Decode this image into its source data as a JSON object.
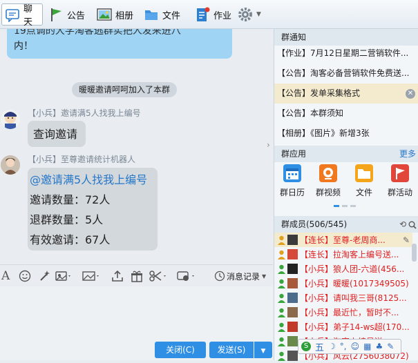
{
  "toolbar": {
    "items": [
      {
        "label": "聊天",
        "icon": "chat-icon"
      },
      {
        "label": "公告",
        "icon": "flag-icon"
      },
      {
        "label": "相册",
        "icon": "photo-icon"
      },
      {
        "label": "文件",
        "icon": "folder-icon"
      },
      {
        "label": "作业",
        "icon": "homework-icon"
      }
    ],
    "settings_icon": "gear-icon"
  },
  "chat": {
    "top_bubble_line1": "19点调的大学淘客逃群实把人发来进八",
    "top_bubble_line2": "内！",
    "system_message": "暖暖邀请呵呵加入了本群",
    "messages": [
      {
        "sender": "【小兵】邀请满5人找我上编号",
        "lines": [
          "查询邀请"
        ]
      },
      {
        "sender": "【小兵】至尊邀请统计机器人",
        "lines": [
          "@邀请满5人找我上编号",
          "邀请数量：72人",
          "退群数量：5人",
          "有效邀请：67人"
        ]
      }
    ]
  },
  "input_toolbar": {
    "history_label": "消息记录"
  },
  "buttons": {
    "close": "关闭(C)",
    "send": "发送(S)"
  },
  "right_panel": {
    "notices_title": "群通知",
    "notices": [
      "【作业】7月12日星期二营销软件...",
      "【公告】淘客必备营销软件免费送...",
      "【公告】发单采集格式",
      "【公告】本群须知",
      "【相册】《图片》新增3张"
    ],
    "apps_title": "群应用",
    "apps_more": "更多",
    "apps": [
      "群日历",
      "群视频",
      "文件",
      "群活动"
    ],
    "members_title": "群成员(506/545)",
    "members": [
      "【连长】至尊-老周商...",
      "【连长】拉淘客上编号送...",
      "【小兵】狼人团-六道(456...",
      "【小兵】暖暖(1017349505)",
      "【小兵】请叫我三哥(8125...",
      "【小兵】最近忙，暂时不...",
      "【小兵】弟子14-ws超(170...",
      "【小兵】淘客上编号送",
      "【小兵】风云(2756038072)"
    ],
    "ime_label": "五"
  },
  "colors": {
    "accent": "#2f8fe4",
    "member_red": "#e02020",
    "bubble_blue": "#9fd4f5"
  }
}
